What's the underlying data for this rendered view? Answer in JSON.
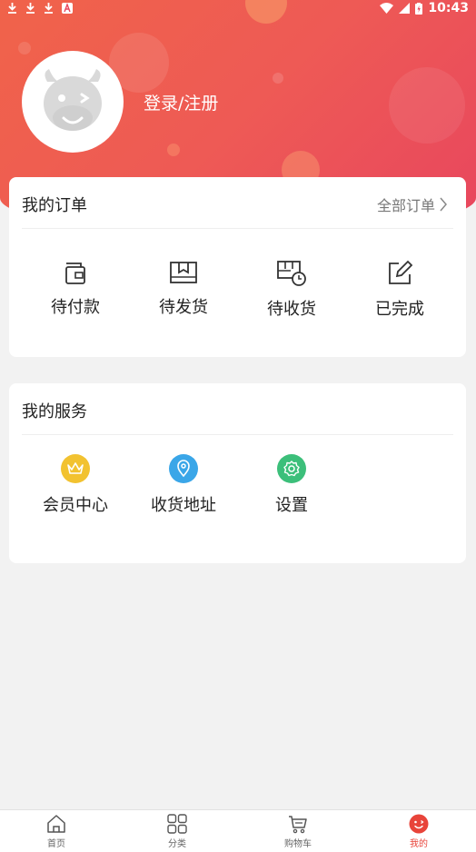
{
  "status_bar": {
    "time": "10:43",
    "left_icons": [
      "download-icon",
      "download-icon",
      "download-icon",
      "a-notification-icon"
    ],
    "right_icons": [
      "wifi-icon",
      "signal-icon",
      "battery-charging-icon"
    ]
  },
  "profile": {
    "login_label": "登录/注册",
    "avatar_icon": "cow-mascot-avatar"
  },
  "orders": {
    "title": "我的订单",
    "all_orders_label": "全部订单",
    "items": [
      {
        "label": "待付款",
        "icon": "wallet-icon"
      },
      {
        "label": "待发货",
        "icon": "package-icon"
      },
      {
        "label": "待收货",
        "icon": "truck-clock-icon"
      },
      {
        "label": "已完成",
        "icon": "edit-icon"
      }
    ]
  },
  "services": {
    "title": "我的服务",
    "items": [
      {
        "label": "会员中心",
        "icon": "crown-icon",
        "color": "#f2c230"
      },
      {
        "label": "收货地址",
        "icon": "location-pin-icon",
        "color": "#3aa6e8"
      },
      {
        "label": "设置",
        "icon": "gear-icon",
        "color": "#3cbf7a"
      }
    ]
  },
  "tabbar": {
    "items": [
      {
        "label": "首页",
        "icon": "home-icon"
      },
      {
        "label": "分类",
        "icon": "grid-icon"
      },
      {
        "label": "购物车",
        "icon": "cart-icon"
      },
      {
        "label": "我的",
        "icon": "profile-face-icon"
      }
    ],
    "active_index": 3,
    "active_color": "#e8443a"
  },
  "colors": {
    "header_start": "#f0634a",
    "header_end": "#e8465e",
    "background": "#f2f2f2"
  }
}
